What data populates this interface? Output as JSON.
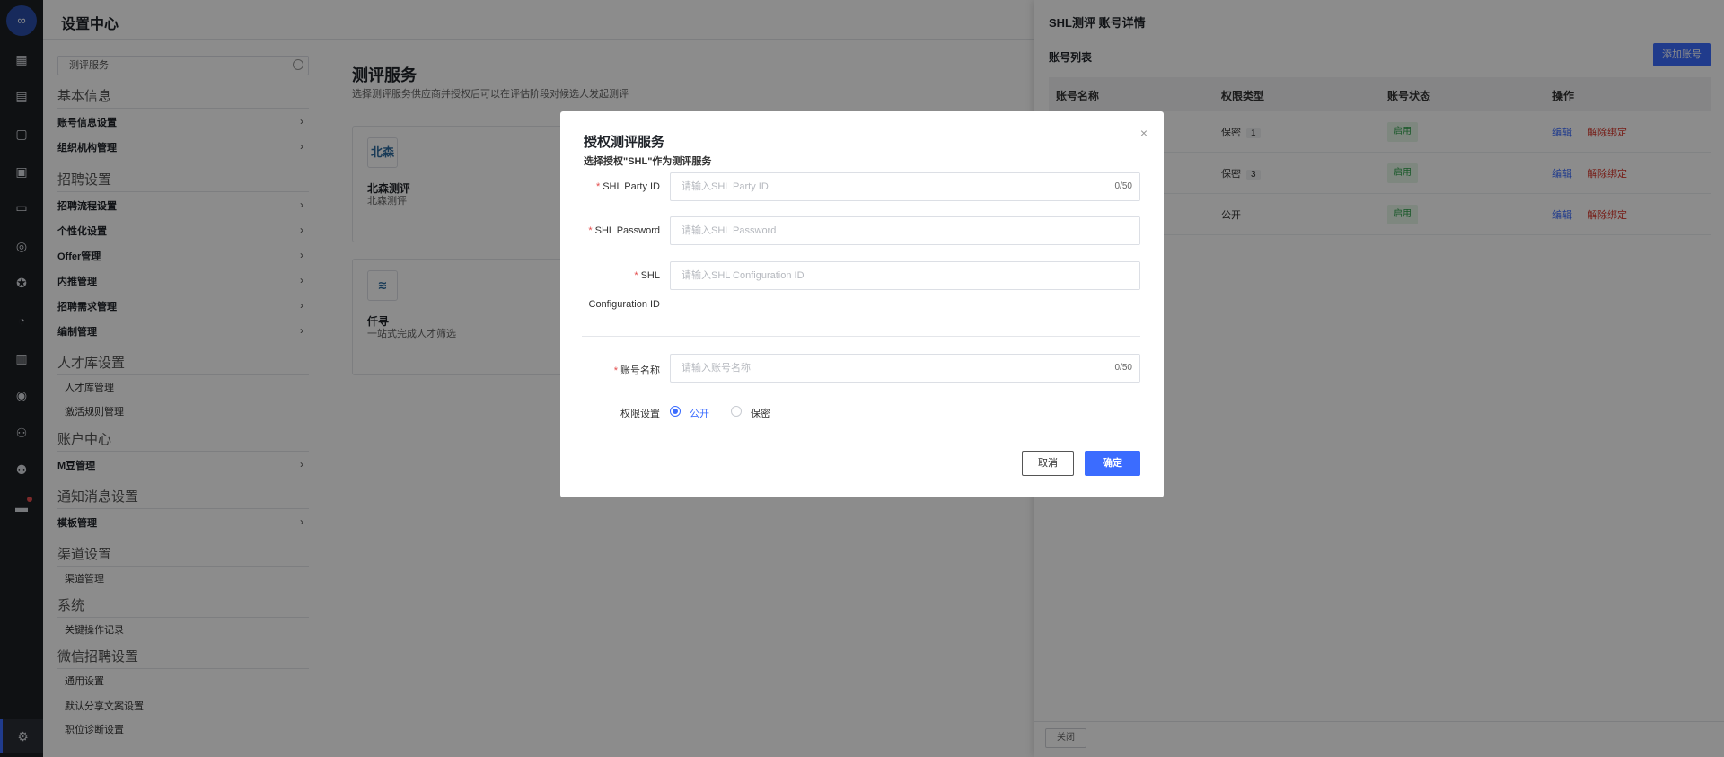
{
  "header": {
    "title": "设置中心"
  },
  "rail": {
    "logo_text": "∞",
    "icons": [
      "dashboard-icon",
      "briefcase-icon",
      "document-icon",
      "calendar-icon",
      "id-card-icon",
      "chat-icon",
      "star-icon",
      "pie-chart-icon",
      "bar-chart-icon",
      "user-circle-icon",
      "team-icon",
      "user-settings-icon",
      "message-icon",
      "settings-icon"
    ]
  },
  "sidebar": {
    "search_value": "测评服务",
    "groups": [
      {
        "title": "基本信息",
        "items": [
          {
            "label": "账号信息设置"
          },
          {
            "label": "组织机构管理"
          }
        ]
      },
      {
        "title": "招聘设置",
        "items": [
          {
            "label": "招聘流程设置"
          },
          {
            "label": "个性化设置"
          },
          {
            "label": "Offer管理"
          },
          {
            "label": "内推管理"
          },
          {
            "label": "招聘需求管理"
          },
          {
            "label": "编制管理"
          }
        ]
      },
      {
        "title": "人才库设置",
        "subs": [
          {
            "label": "人才库管理"
          },
          {
            "label": "激活规则管理"
          }
        ]
      },
      {
        "title": "账户中心",
        "items": [
          {
            "label": "M豆管理"
          }
        ]
      },
      {
        "title": "通知消息设置",
        "items": [
          {
            "label": "模板管理"
          }
        ]
      },
      {
        "title": "渠道设置",
        "subs": [
          {
            "label": "渠道管理"
          }
        ]
      },
      {
        "title": "系统",
        "subs": [
          {
            "label": "关键操作记录"
          }
        ]
      },
      {
        "title": "微信招聘设置",
        "subs": [
          {
            "label": "通用设置"
          },
          {
            "label": "默认分享文案设置"
          },
          {
            "label": "职位诊断设置"
          }
        ]
      }
    ]
  },
  "main": {
    "title": "测评服务",
    "desc": "选择测评服务供应商并授权后可以在评估阶段对候选人发起测评",
    "cards": [
      {
        "icon_text": "北森",
        "name": "北森测评",
        "desc": "北森测评"
      },
      {
        "icon_text": "≋",
        "name": "仟寻",
        "desc": "一站式完成人才筛选"
      }
    ]
  },
  "drawer": {
    "title": "SHL测评 账号详情",
    "list_title": "账号列表",
    "add_button": "添加账号",
    "columns": [
      "账号名称",
      "权限类型",
      "账号状态",
      "操作"
    ],
    "rows": [
      {
        "type": "保密",
        "count": "1",
        "status": "启用",
        "edit": "编辑",
        "unbind": "解除绑定"
      },
      {
        "type": "保密",
        "count": "3",
        "status": "启用",
        "edit": "编辑",
        "unbind": "解除绑定"
      },
      {
        "type": "公开",
        "count": "",
        "status": "启用",
        "edit": "编辑",
        "unbind": "解除绑定"
      }
    ],
    "close_button": "关闭"
  },
  "modal": {
    "title": "授权测评服务",
    "subtitle": "选择授权\"SHL\"作为测评服务",
    "close": "×",
    "fields": [
      {
        "label": "SHL Party ID",
        "placeholder": "请输入SHL Party ID",
        "counter": "0/50"
      },
      {
        "label": "SHL Password",
        "placeholder": "请输入SHL Password",
        "counter": ""
      },
      {
        "label": "SHL",
        "label2": "Configuration ID",
        "placeholder": "请输入SHL Configuration ID",
        "counter": ""
      },
      {
        "label": "账号名称",
        "placeholder": "请输入账号名称",
        "counter": "0/50"
      }
    ],
    "permission": {
      "label": "权限设置",
      "options": [
        "公开",
        "保密"
      ],
      "selected": "公开"
    },
    "cancel": "取消",
    "confirm": "确定"
  },
  "colors": {
    "primary": "#3b6cff",
    "required": "#e34d4d",
    "success": "#2ca049",
    "danger": "#d8382c"
  }
}
